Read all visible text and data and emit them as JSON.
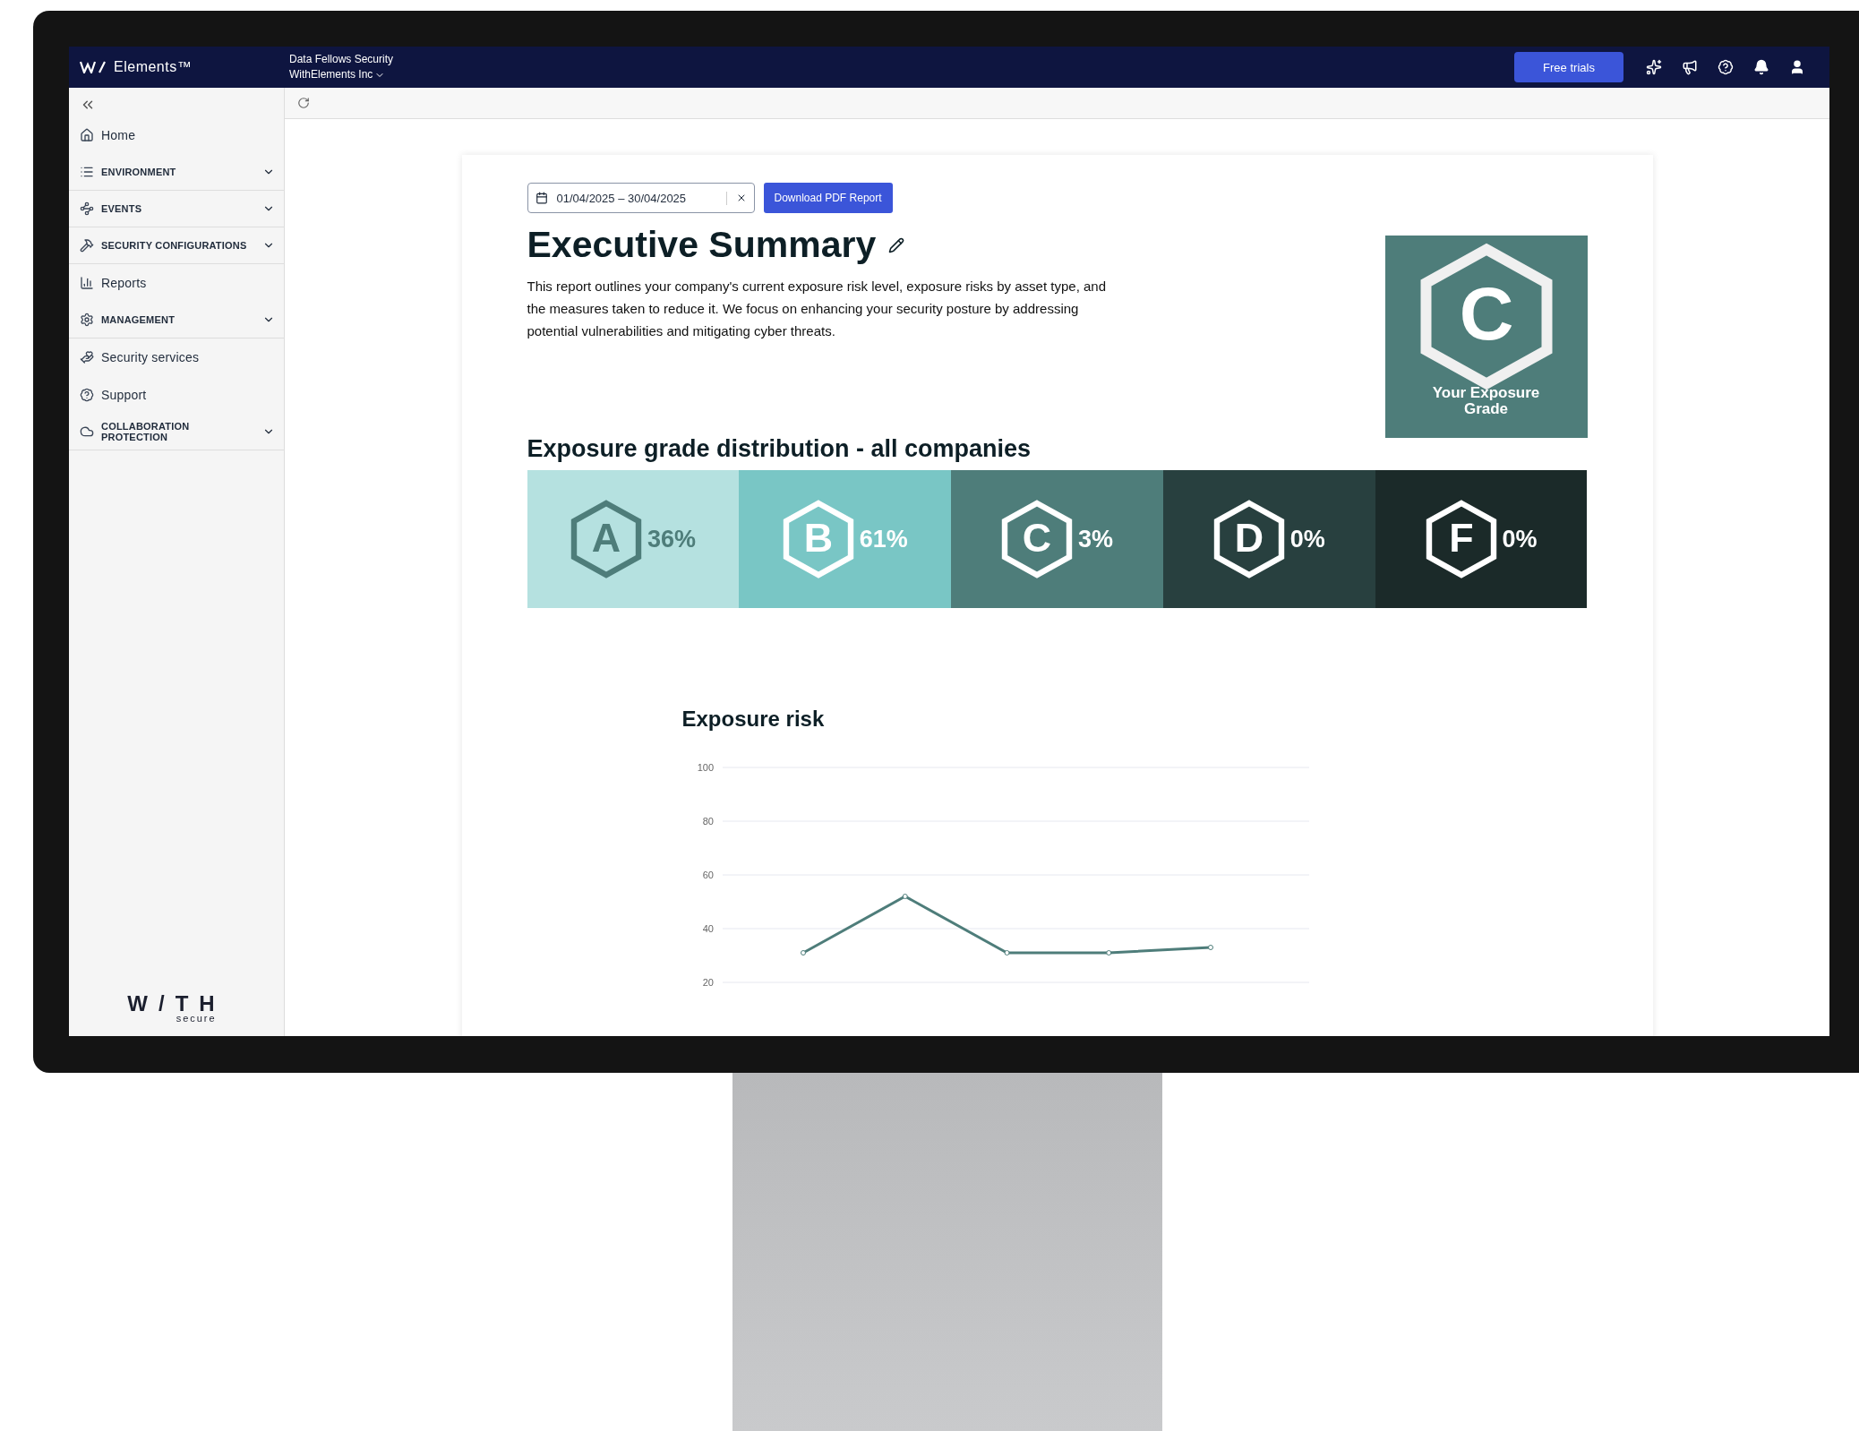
{
  "topbar": {
    "logo": "Elements™",
    "org_name": "Data Fellows Security",
    "account": "WithElements Inc",
    "trial_button": "Free trials"
  },
  "sidebar": {
    "items": [
      {
        "kind": "link",
        "label": "Home"
      },
      {
        "kind": "section",
        "label": "ENVIRONMENT",
        "expanded": false
      },
      {
        "kind": "section",
        "label": "EVENTS",
        "expanded": false
      },
      {
        "kind": "section",
        "label": "SECURITY CONFIGURATIONS",
        "expanded": false
      },
      {
        "kind": "link",
        "label": "Reports"
      },
      {
        "kind": "section",
        "label": "MANAGEMENT",
        "expanded": false
      },
      {
        "kind": "link",
        "label": "Security services"
      },
      {
        "kind": "link",
        "label": "Support"
      },
      {
        "kind": "section",
        "label": "COLLABORATION PROTECTION",
        "expanded": false
      }
    ],
    "brand": {
      "word": "W/TH",
      "sub": "secure"
    }
  },
  "report": {
    "date_range": "01/04/2025 – 30/04/2025",
    "download_button": "Download PDF Report",
    "title": "Executive Summary",
    "intro": "This report outlines your company's current exposure risk level, exposure risks by asset type, and the measures taken to reduce it. We focus on enhancing your security posture by addressing potential vulnerabilities and mitigating cyber threats.",
    "grade": {
      "letter": "C",
      "caption": "Your Exposure Grade"
    },
    "distribution_title": "Exposure grade distribution - all companies",
    "distribution": [
      {
        "letter": "A",
        "percent": "36%",
        "color": "#b5e1e0"
      },
      {
        "letter": "B",
        "percent": "61%",
        "color": "#79c6c5"
      },
      {
        "letter": "C",
        "percent": "3%",
        "color": "#4e7d7a"
      },
      {
        "letter": "D",
        "percent": "0%",
        "color": "#28403f"
      },
      {
        "letter": "F",
        "percent": "0%",
        "color": "#1b2a29"
      }
    ],
    "risk_chart": {
      "chart_data": {
        "type": "line",
        "title": "Exposure risk",
        "grid": true,
        "ylim": [
          20,
          100
        ],
        "yticks": [
          20,
          40,
          60,
          80,
          100
        ],
        "series": [
          {
            "color": "#4e7d7a",
            "marker": true,
            "values": [
              31,
              52,
              31,
              31,
              33
            ]
          }
        ]
      }
    }
  }
}
